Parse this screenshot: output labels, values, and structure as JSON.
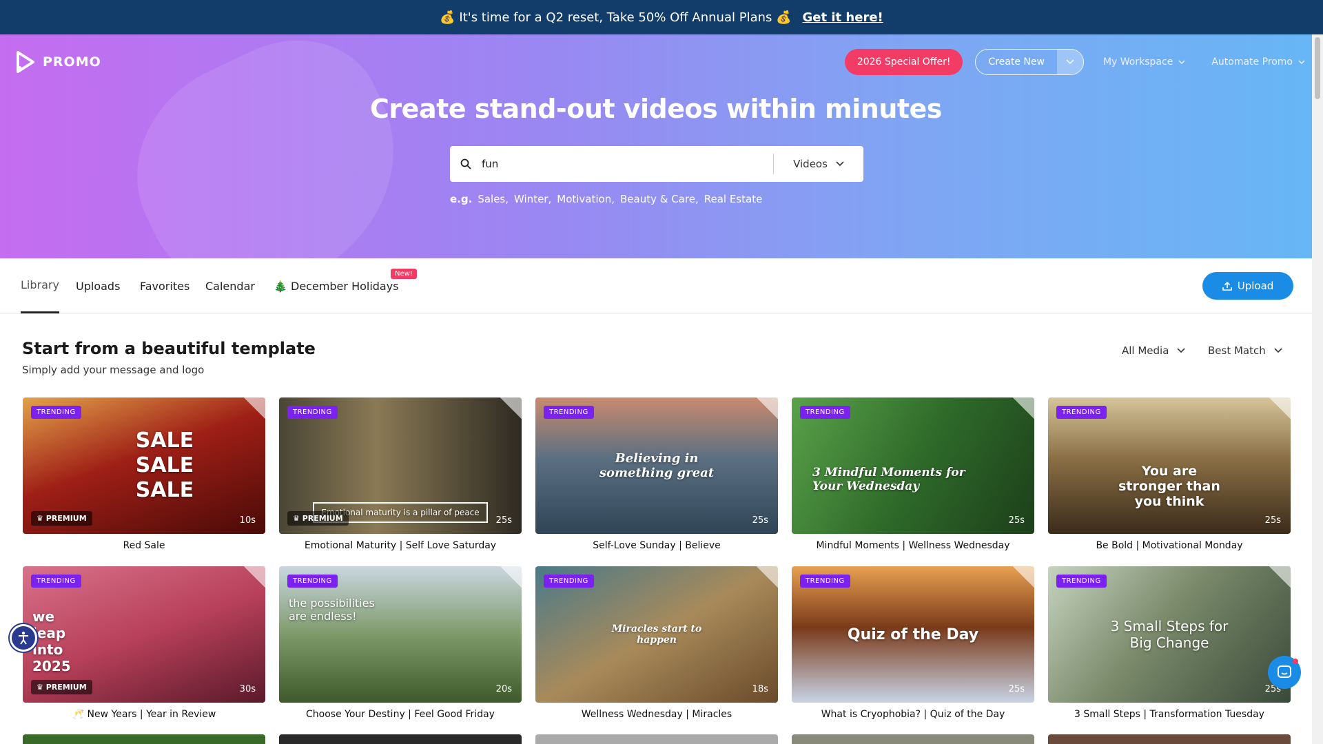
{
  "banner": {
    "text": "💰 It's time for a Q2 reset, Take 50% Off Annual Plans 💰",
    "cta": "Get it here!"
  },
  "header": {
    "logo": "PROMO",
    "special_offer": "2026 Special Offer!",
    "create_new": "Create New",
    "workspace": "My Workspace",
    "automate": "Automate Promo"
  },
  "hero": {
    "title": "Create stand-out videos within minutes",
    "search_value": "fun",
    "search_type": "Videos",
    "eg_label": "e.g.",
    "suggestions": [
      "Sales,",
      "Winter,",
      "Motivation,",
      "Beauty & Care,",
      "Real Estate"
    ]
  },
  "tabs": [
    "Library",
    "Uploads",
    "Favorites",
    "Calendar",
    "🎄 December Holidays"
  ],
  "new_badge": "New!",
  "upload_label": "Upload",
  "section": {
    "title": "Start from a beautiful template",
    "subtitle": "Simply add your message and logo"
  },
  "filters": {
    "media": "All Media",
    "sort": "Best Match"
  },
  "badges": {
    "trending": "TRENDING",
    "premium": "PREMIUM"
  },
  "cards": [
    {
      "title": "Red Sale",
      "duration": "10s",
      "premium": true,
      "overlay": "SALE SALE SALE",
      "bg": "linear-gradient(160deg,#e3a24a 0%,#9e1f16 45%,#4a0a08 100%)"
    },
    {
      "title": "Emotional Maturity | Self Love Saturday",
      "duration": "25s",
      "premium": true,
      "overlay": "Emotional maturity is a pillar of peace",
      "bg": "linear-gradient(90deg,#4a4535 0%,#8a7a55 40%,#2e2a22 100%)"
    },
    {
      "title": "Self-Love Sunday | Believe",
      "duration": "25s",
      "premium": false,
      "overlay": "Believing in something great",
      "bg": "linear-gradient(180deg,#c98a6e 0%,#5b6f82 45%,#2f4556 100%)"
    },
    {
      "title": "Mindful Moments | Wellness Wednesday",
      "duration": "25s",
      "premium": false,
      "overlay": "3 Mindful Moments for Your Wednesday",
      "bg": "linear-gradient(120deg,#5aa24a 0%,#2f6b2a 50%,#1c3f1a 100%)"
    },
    {
      "title": "Be Bold | Motivational Monday",
      "duration": "25s",
      "premium": false,
      "overlay": "You are stronger than you think",
      "bg": "linear-gradient(180deg,#d6c49a 0%,#8a6f45 45%,#3b2b1a 100%)"
    },
    {
      "title": "🥂 New Years | Year in Review",
      "duration": "30s",
      "premium": true,
      "overlay": "we leap into 2025",
      "bg": "linear-gradient(160deg,#d8728a 0%,#b8405a 50%,#5a1a2a 100%)"
    },
    {
      "title": "Choose Your Destiny | Feel Good Friday",
      "duration": "20s",
      "premium": false,
      "overlay": "the possibilities are endless!",
      "bg": "linear-gradient(180deg,#c9d6e0 0%,#7f9a6a 50%,#3e5a2a 100%)"
    },
    {
      "title": "Wellness Wednesday | Miracles",
      "duration": "18s",
      "premium": false,
      "overlay": "Miracles start to happen",
      "bg": "linear-gradient(150deg,#4a7a8a 0%,#a88a5a 50%,#6a4a2a 100%)"
    },
    {
      "title": "What is Cryophobia? | Quiz of the Day",
      "duration": "25s",
      "premium": false,
      "overlay": "Quiz of the Day",
      "bg": "linear-gradient(180deg,#e8a050 0%,#7a3a1a 45%,#c8d4e6 100%)"
    },
    {
      "title": "3 Small Steps | Transformation Tuesday",
      "duration": "25s",
      "premium": false,
      "overlay": "3 Small Steps for Big Change",
      "bg": "linear-gradient(130deg,#c6d4c0 0%,#7a8a6a 45%,#3a4a3a 100%)"
    }
  ],
  "peek_colors": [
    "#3a6a2a",
    "#2a2a2a",
    "#aaaaaa",
    "#8a8a7a",
    "#6a4a3a"
  ]
}
